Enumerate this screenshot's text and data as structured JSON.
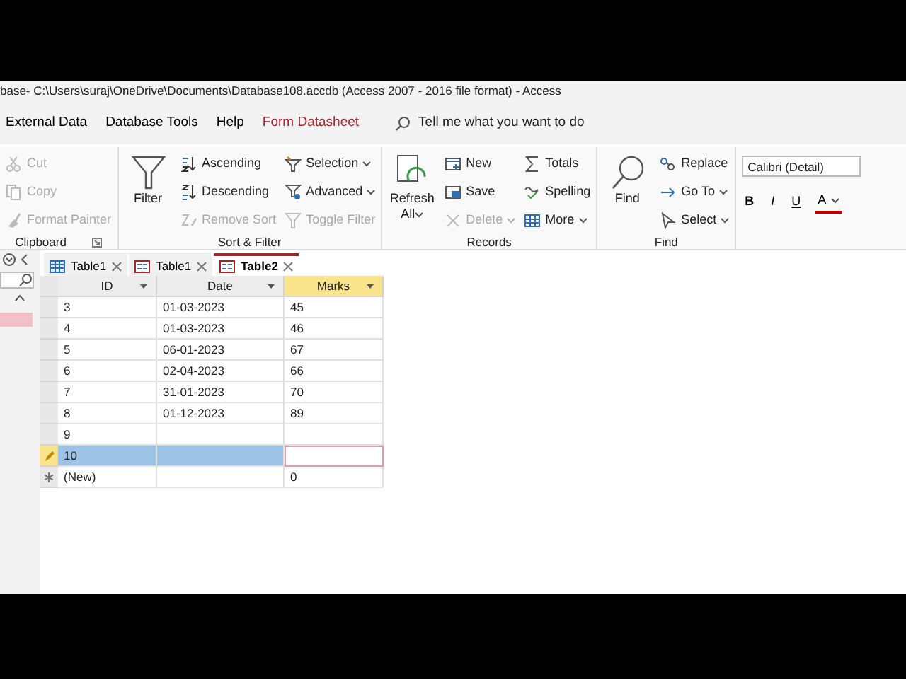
{
  "window": {
    "title": "base- C:\\Users\\suraj\\OneDrive\\Documents\\Database108.accdb (Access 2007 - 2016 file format)  -  Access"
  },
  "ribbon_tabs": [
    {
      "label": "External Data",
      "kind": "normal"
    },
    {
      "label": "Database Tools",
      "kind": "normal"
    },
    {
      "label": "Help",
      "kind": "normal"
    },
    {
      "label": "Form Datasheet",
      "kind": "contextual"
    }
  ],
  "tell_me": {
    "placeholder": "Tell me what you want to do"
  },
  "ribbon_groups": [
    {
      "label": "Clipboard",
      "launcher": true,
      "columns": [
        [
          {
            "label": "Cut",
            "disabled": true,
            "dropdown": false
          },
          {
            "label": "Copy",
            "disabled": true,
            "dropdown": false
          },
          {
            "label": "Format Painter",
            "disabled": true,
            "dropdown": false
          }
        ]
      ]
    },
    {
      "label": "Sort & Filter",
      "launcher": false,
      "large": {
        "label": "Filter",
        "dropdown": false
      },
      "columns": [
        [
          {
            "label": "Ascending",
            "disabled": false,
            "dropdown": false
          },
          {
            "label": "Descending",
            "disabled": false,
            "dropdown": false
          },
          {
            "label": "Remove Sort",
            "disabled": true,
            "dropdown": false
          }
        ],
        [
          {
            "label": "Selection",
            "disabled": false,
            "dropdown": true
          },
          {
            "label": "Advanced",
            "disabled": false,
            "dropdown": true
          },
          {
            "label": "Toggle Filter",
            "disabled": true,
            "dropdown": false
          }
        ]
      ]
    },
    {
      "label": "Records",
      "launcher": false,
      "large": {
        "label": "Refresh All",
        "dropdown": true
      },
      "columns": [
        [
          {
            "label": "New",
            "disabled": false,
            "dropdown": false
          },
          {
            "label": "Save",
            "disabled": false,
            "dropdown": false
          },
          {
            "label": "Delete",
            "disabled": true,
            "dropdown": true
          }
        ],
        [
          {
            "label": "Totals",
            "disabled": false,
            "dropdown": false
          },
          {
            "label": "Spelling",
            "disabled": false,
            "dropdown": false
          },
          {
            "label": "More",
            "disabled": false,
            "dropdown": true
          }
        ]
      ]
    },
    {
      "label": "Find",
      "launcher": false,
      "large": {
        "label": "Find",
        "dropdown": false
      },
      "columns": [
        [
          {
            "label": "Replace",
            "disabled": false,
            "dropdown": false
          },
          {
            "label": "Go To",
            "disabled": false,
            "dropdown": true
          },
          {
            "label": "Select",
            "disabled": false,
            "dropdown": true
          }
        ]
      ]
    }
  ],
  "text_formatting": {
    "font": "Calibri (Detail)",
    "buttons": [
      "B",
      "I",
      "U",
      "A"
    ]
  },
  "doc_tabs": [
    {
      "label": "Table1",
      "kind": "table",
      "selected": false
    },
    {
      "label": "Table1",
      "kind": "form",
      "selected": false
    },
    {
      "label": "Table2",
      "kind": "form",
      "selected": true
    }
  ],
  "grid": {
    "columns": [
      {
        "label": "ID",
        "selected": false
      },
      {
        "label": "Date",
        "selected": false
      },
      {
        "label": "Marks",
        "selected": true
      }
    ],
    "rows": [
      {
        "cells": [
          "3",
          "01-03-2023",
          "45"
        ],
        "editing": false,
        "new_record": false
      },
      {
        "cells": [
          "4",
          "01-03-2023",
          "46"
        ],
        "editing": false,
        "new_record": false
      },
      {
        "cells": [
          "5",
          "06-01-2023",
          "67"
        ],
        "editing": false,
        "new_record": false
      },
      {
        "cells": [
          "6",
          "02-04-2023",
          "66"
        ],
        "editing": false,
        "new_record": false
      },
      {
        "cells": [
          "7",
          "31-01-2023",
          "70"
        ],
        "editing": false,
        "new_record": false
      },
      {
        "cells": [
          "8",
          "01-12-2023",
          "89"
        ],
        "editing": false,
        "new_record": false
      },
      {
        "cells": [
          "9"
        ],
        "editing": false,
        "new_record": false
      },
      {
        "cells": [
          "10"
        ],
        "editing": true,
        "new_record": false
      },
      {
        "cells": [
          "(New)",
          "",
          "0"
        ],
        "editing": false,
        "new_record": true
      }
    ]
  }
}
